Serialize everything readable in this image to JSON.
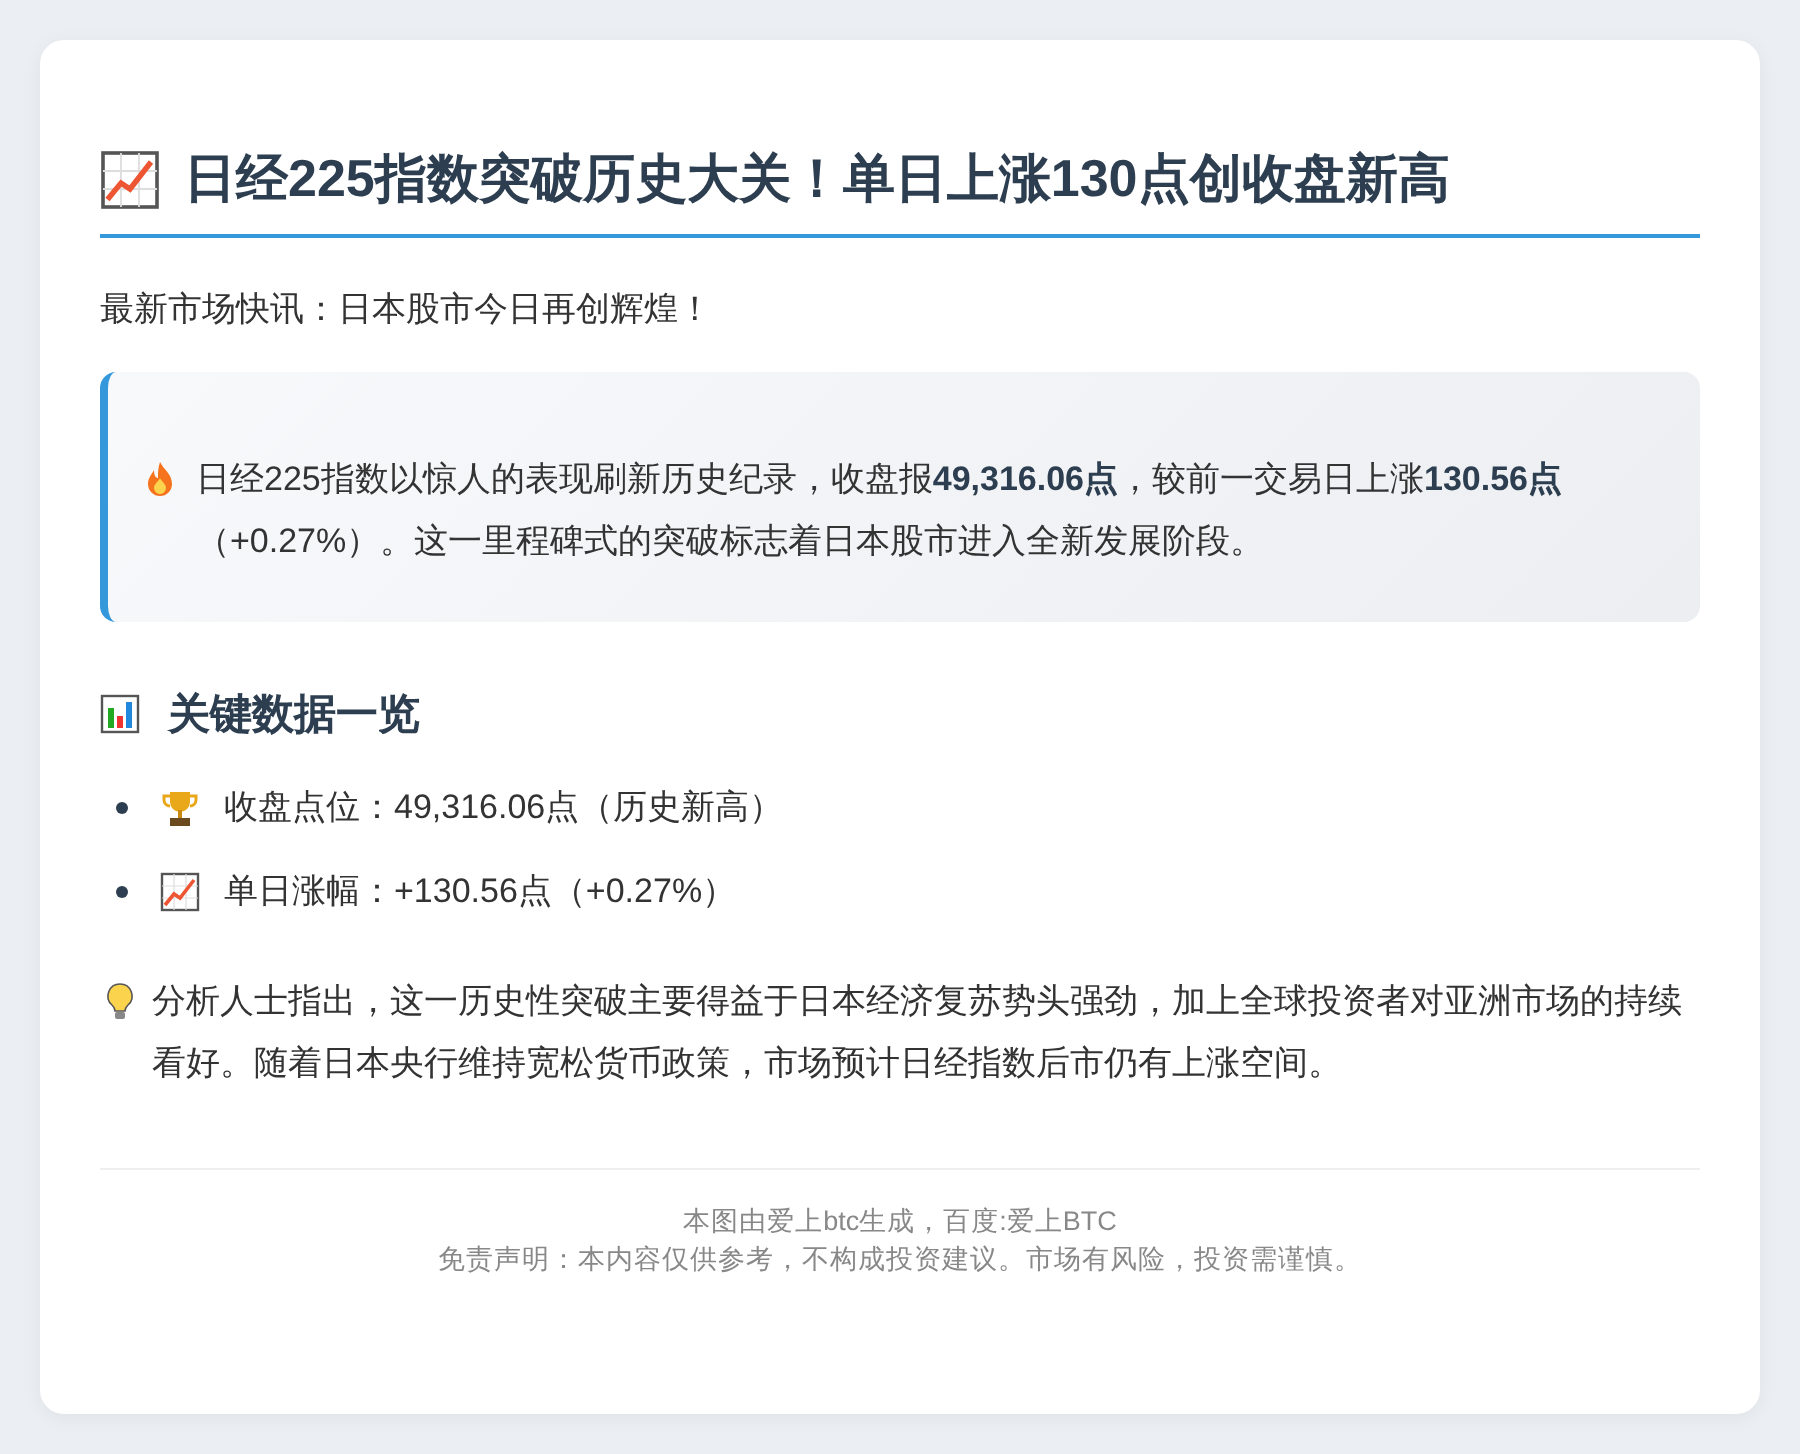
{
  "title": "日经225指数突破历史大关！单日上涨130点创收盘新高",
  "intro": "最新市场快讯：日本股市今日再创辉煌！",
  "highlight": "日经225指数以惊人的表现刷新历史纪录，收盘报**49,316.06点**，较前一交易日上涨**130.56点**（+0.27%）。这一里程碑式的突破标志着日本股市进入全新发展阶段。",
  "section_title": "关键数据一览",
  "key_points": [
    {
      "kind": "trophy",
      "text": "收盘点位：49,316.06点（历史新高）"
    },
    {
      "kind": "chart",
      "text": "单日涨幅：+130.56点（+0.27%）"
    }
  ],
  "analysis": "分析人士指出，这一历史性突破主要得益于日本经济复苏势头强劲，加上全球投资者对亚洲市场的持续看好。随着日本央行维持宽松货币政策，市场预计日经指数后市仍有上涨空间。",
  "footer": [
    "本图由爱上btc生成，百度:爱上BTC",
    "免责声明：本内容仅供参考，不构成投资建议。市场有风险，投资需谨慎。"
  ]
}
